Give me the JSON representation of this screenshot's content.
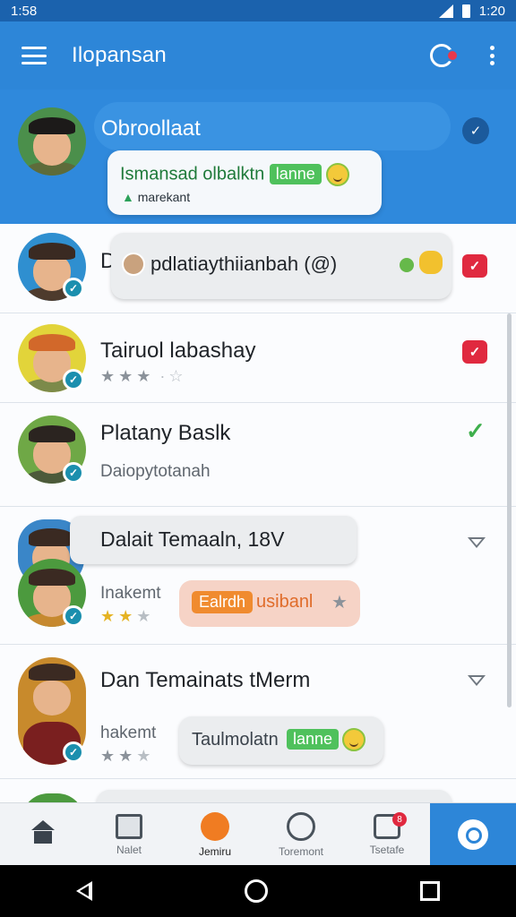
{
  "status_bar": {
    "time": "1:58",
    "clock_right": "1:20"
  },
  "app_bar": {
    "title": "Ilopansan",
    "icons": [
      "menu-icon",
      "chat-action-icon",
      "kebab-icon"
    ]
  },
  "chats": [
    {
      "name": "Obroollaat",
      "bubble_text": "Ismansad olbalktn",
      "bubble_tag": "lanne",
      "bubble_sub": "marekant",
      "selected": true
    },
    {
      "name": "D",
      "bubble_text": "pdlatiaythiianbah (@)"
    },
    {
      "name": "Tairuol labashay",
      "rating": 3
    },
    {
      "name": "Platany Baslk",
      "subtitle": "Daiopytotanah"
    },
    {
      "name": "Dalait Temaaln, 18V",
      "subtitle": "Inakemt",
      "bubble_tag": "Ealrdh",
      "bubble_text": "usibanl",
      "rating": 2
    },
    {
      "name": "Dan Temainats tMerm",
      "subtitle": "hakemt",
      "bubble_text": "Taulmolatn",
      "bubble_tag": "lanne",
      "rating": 2
    }
  ],
  "bottom_nav": [
    {
      "label": "",
      "icon": "home-icon"
    },
    {
      "label": "Nalet",
      "icon": "image-icon"
    },
    {
      "label": "Jemiru",
      "icon": "chat-bubble-icon",
      "active": true
    },
    {
      "label": "Toremont",
      "icon": "community-icon"
    },
    {
      "label": "Tsetafe",
      "icon": "notifications-icon",
      "badge": "8"
    }
  ],
  "colors": {
    "primary": "#2d86d8",
    "status_bar": "#1b62ad",
    "accent_orange": "#f07c22",
    "alert_red": "#e0293f",
    "success_green": "#3eaf4c"
  }
}
